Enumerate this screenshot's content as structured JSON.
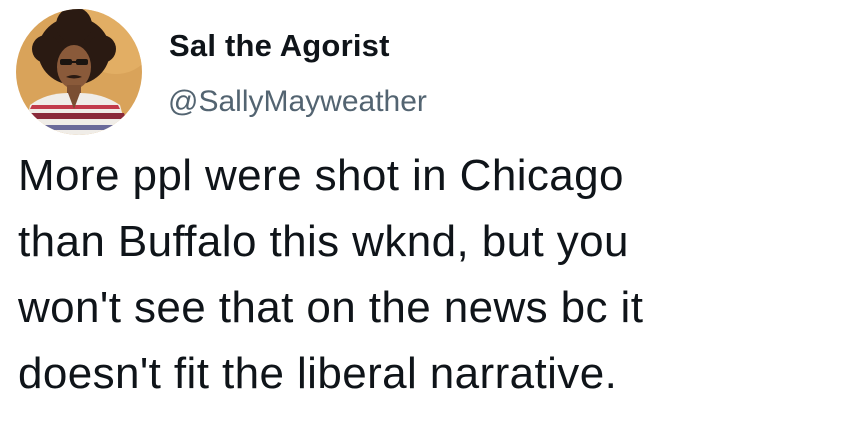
{
  "tweet": {
    "author": {
      "display_name": "Sal the Agorist",
      "handle": "@SallyMayweather",
      "avatar_icon": "user-avatar"
    },
    "text_lines": [
      "More ppl were shot in Chicago",
      "than Buffalo this wknd, but you",
      "won't see that on the news bc it",
      "doesn't fit the liberal narrative."
    ]
  },
  "colors": {
    "text": "#0f1419",
    "handle": "#536471",
    "background": "#ffffff",
    "avatar_bg": "#d9a35a"
  }
}
